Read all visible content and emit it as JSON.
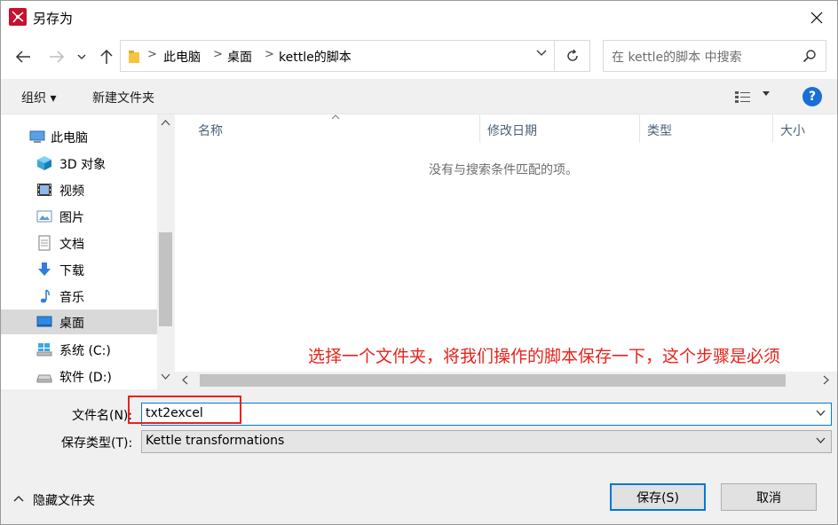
{
  "window": {
    "title": "另存为",
    "accent": "#0078d7"
  },
  "nav": {
    "breadcrumbs": [
      "此电脑",
      "桌面",
      "kettle的脚本"
    ],
    "search_placeholder": "在 kettle的脚本 中搜索"
  },
  "toolbar": {
    "organize": "组织 ▾",
    "new_folder": "新建文件夹",
    "help": "?"
  },
  "sidebar": {
    "items": [
      {
        "label": "此电脑",
        "icon": "computer-icon"
      },
      {
        "label": "3D 对象",
        "icon": "cube-icon"
      },
      {
        "label": "视频",
        "icon": "video-icon"
      },
      {
        "label": "图片",
        "icon": "picture-icon"
      },
      {
        "label": "文档",
        "icon": "document-icon"
      },
      {
        "label": "下载",
        "icon": "download-icon"
      },
      {
        "label": "音乐",
        "icon": "music-icon"
      },
      {
        "label": "桌面",
        "icon": "desktop-icon",
        "selected": true
      },
      {
        "label": "系统 (C:)",
        "icon": "system-drive-icon"
      },
      {
        "label": "软件 (D:)",
        "icon": "drive-icon"
      }
    ]
  },
  "filelist": {
    "columns": [
      "名称",
      "修改日期",
      "类型",
      "大小"
    ],
    "empty_message": "没有与搜索条件匹配的项。"
  },
  "annotation": {
    "text": "选择一个文件夹，将我们操作的脚本保存一下，这个步骤是必须",
    "color": "#e8231b"
  },
  "form": {
    "filename_label": "文件名(N):",
    "filename_value": "txt2excel",
    "filetype_label": "保存类型(T):",
    "filetype_value": "Kettle transformations"
  },
  "footer": {
    "hide_folders": "隐藏文件夹",
    "save": "保存(S)",
    "cancel": "取消"
  }
}
